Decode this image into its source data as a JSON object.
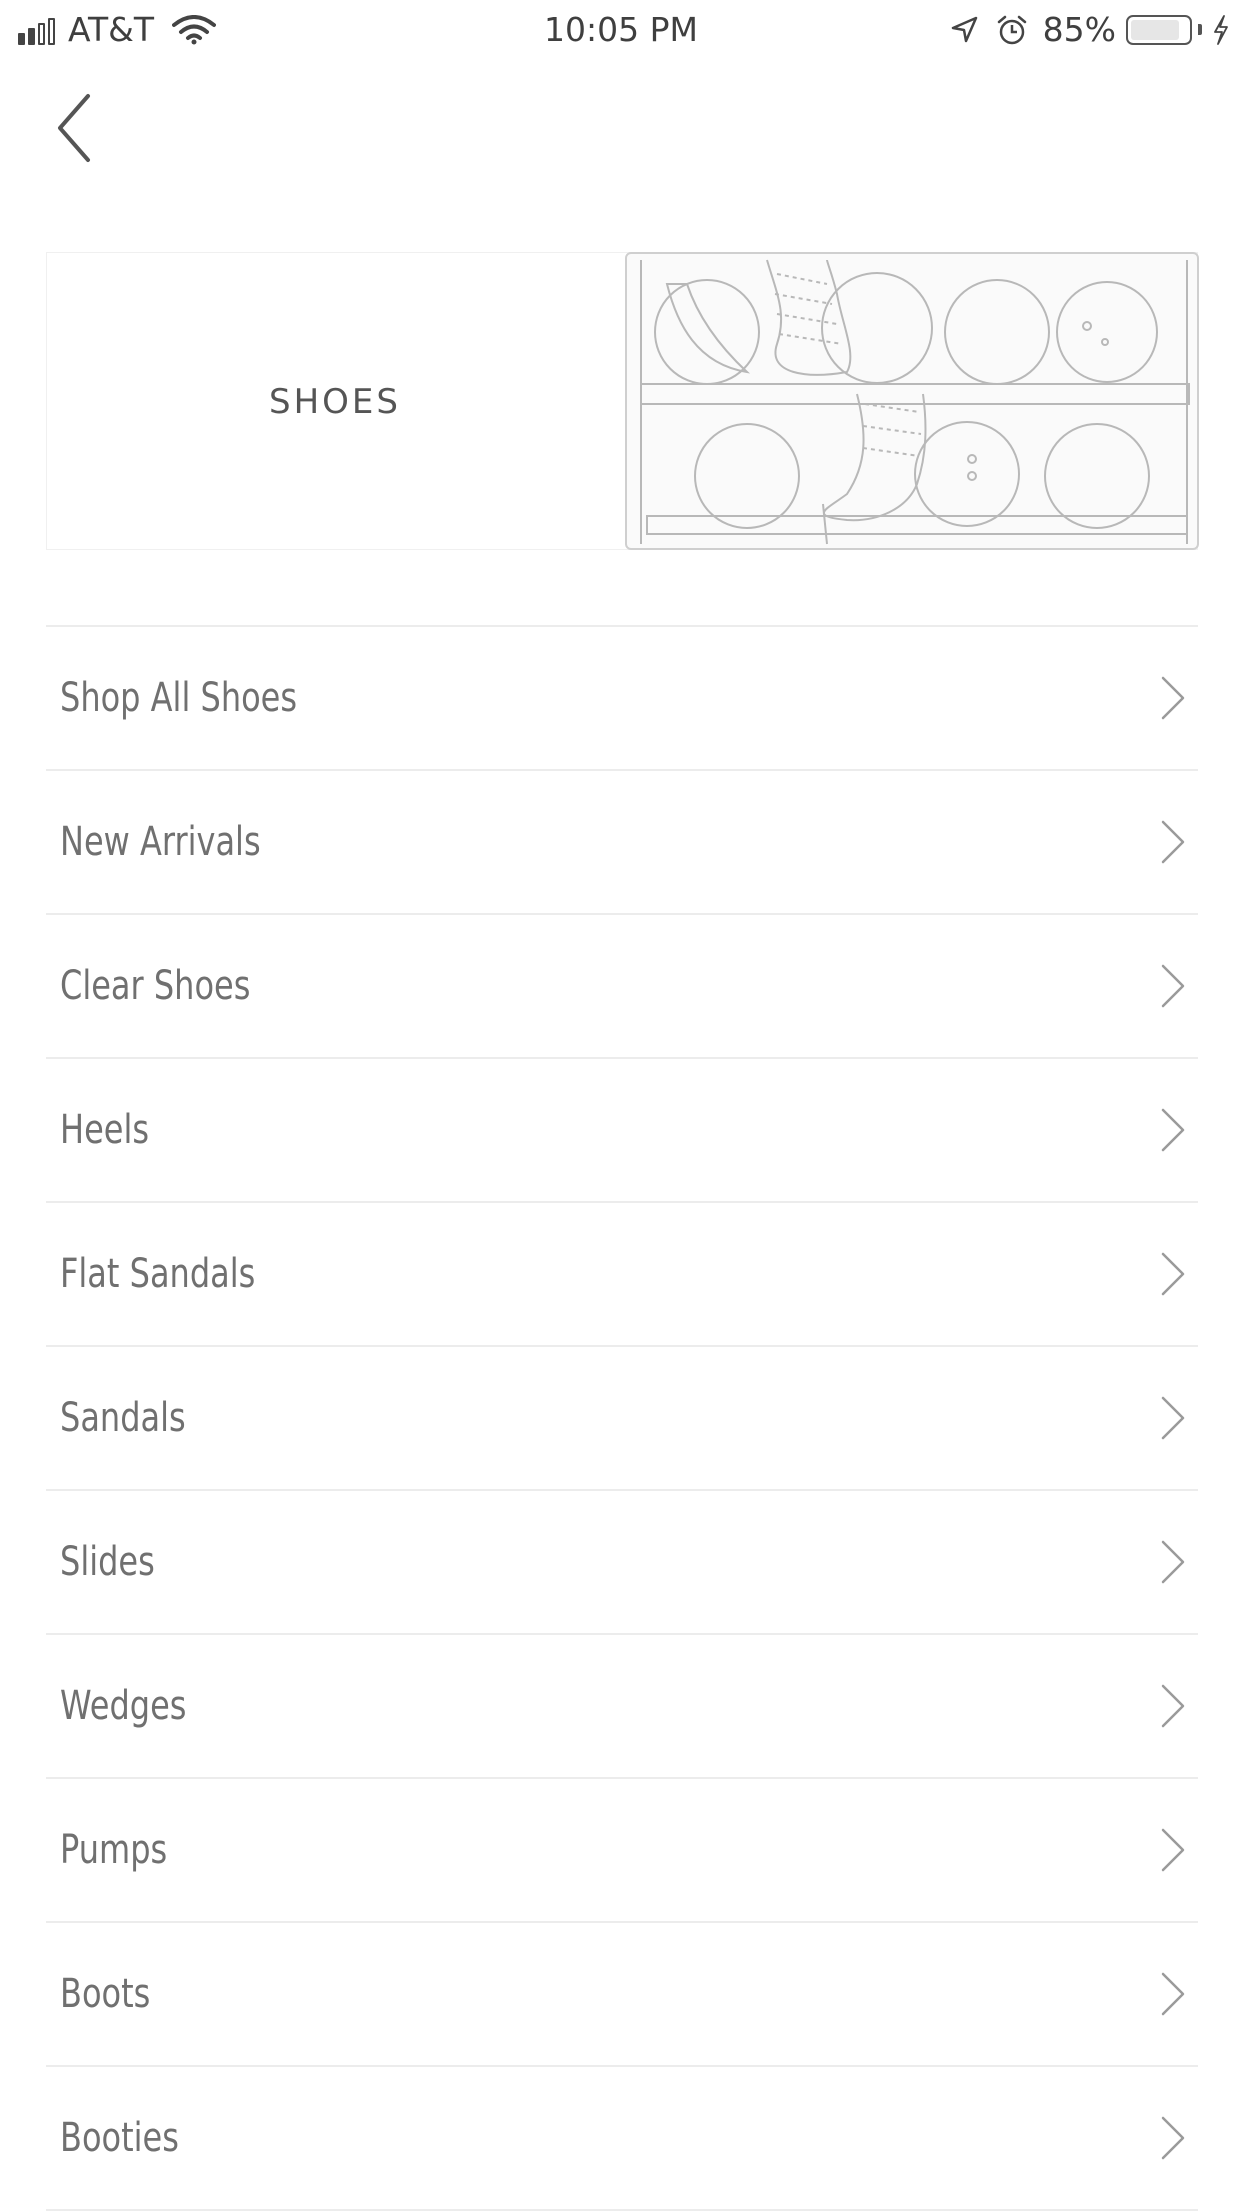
{
  "status_bar": {
    "carrier": "AT&T",
    "time": "10:05 PM",
    "battery_percent": "85%",
    "battery_level": 0.85,
    "signal_bars_filled": 2,
    "signal_bars_total": 4
  },
  "nav": {
    "back_icon": "chevron-left-icon"
  },
  "banner": {
    "title": "SHOES",
    "image_icon": "shoe-shelf-sketch-image"
  },
  "menu": {
    "items": [
      {
        "label": "Shop All Shoes"
      },
      {
        "label": "New Arrivals"
      },
      {
        "label": "Clear Shoes"
      },
      {
        "label": "Heels"
      },
      {
        "label": "Flat Sandals"
      },
      {
        "label": "Sandals"
      },
      {
        "label": "Slides"
      },
      {
        "label": "Wedges"
      },
      {
        "label": "Pumps"
      },
      {
        "label": "Boots"
      },
      {
        "label": "Booties"
      }
    ],
    "chevron_icon": "chevron-right-icon"
  },
  "colors": {
    "text": "#707070",
    "divider": "#ececec",
    "background": "#ffffff"
  }
}
